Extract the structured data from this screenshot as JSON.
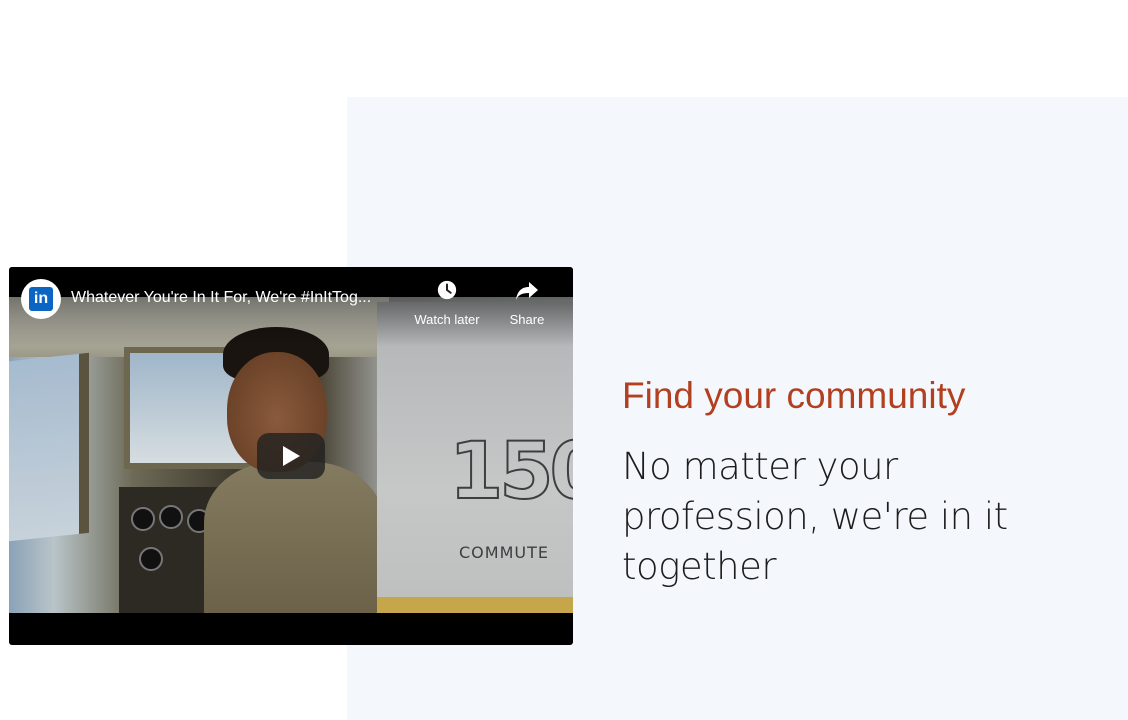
{
  "video": {
    "title": "Whatever You're In It For, We're #InItTog...",
    "channel_logo_text": "in",
    "watch_later_label": "Watch later",
    "share_label": "Share",
    "scene_tail_number": "150",
    "scene_tail_word": "COMMUTE"
  },
  "content": {
    "headline": "Find your community",
    "subline": "No matter your profession, we're in it together"
  },
  "colors": {
    "headline": "#b24020",
    "panel_background": "#f4f8fd",
    "linkedin_blue": "#0a66c2"
  }
}
